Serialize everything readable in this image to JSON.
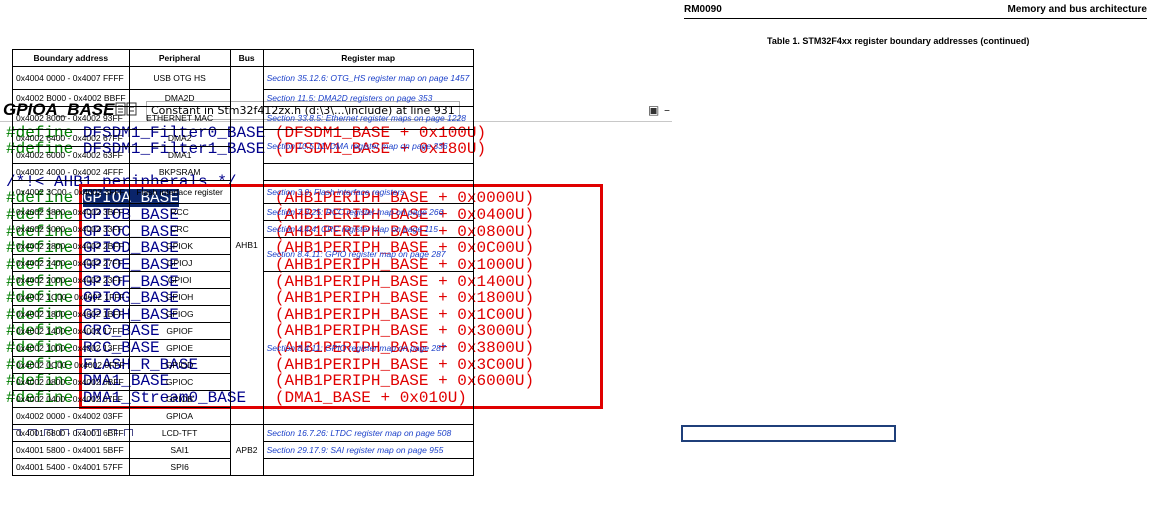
{
  "editor": {
    "symbol_name": "GPIOA_BASE",
    "tooltip": "Constant in Stm32f412zx.h (d:\\3\\...\\include) at line 931",
    "pin_glyph": "▣",
    "minimize_glyph": "–",
    "lines": [
      {
        "kw": "#define",
        "name": "DFSDM1_Filter0_BASE",
        "value": "(DFSDM1_BASE + 0x100U)"
      },
      {
        "kw": "#define",
        "name": "DFSDM1_Filter1_BASE",
        "value": "(DFSDM1_BASE + 0x180U)"
      },
      {
        "comment": "/*!< AHB1 peripherals */"
      },
      {
        "kw": "#define",
        "name": "GPIOA_BASE",
        "value": "(AHB1PERIPH_BASE + 0x0000U)",
        "selected": true
      },
      {
        "kw": "#define",
        "name": "GPIOB_BASE",
        "value": "(AHB1PERIPH_BASE + 0x0400U)"
      },
      {
        "kw": "#define",
        "name": "GPIOC_BASE",
        "value": "(AHB1PERIPH_BASE + 0x0800U)"
      },
      {
        "kw": "#define",
        "name": "GPIOD_BASE",
        "value": "(AHB1PERIPH_BASE + 0x0C00U)"
      },
      {
        "kw": "#define",
        "name": "GPIOE_BASE",
        "value": "(AHB1PERIPH_BASE + 0x1000U)"
      },
      {
        "kw": "#define",
        "name": "GPIOF_BASE",
        "value": "(AHB1PERIPH_BASE + 0x1400U)"
      },
      {
        "kw": "#define",
        "name": "GPIOG_BASE",
        "value": "(AHB1PERIPH_BASE + 0x1800U)"
      },
      {
        "kw": "#define",
        "name": "GPIOH_BASE",
        "value": "(AHB1PERIPH_BASE + 0x1C00U)"
      },
      {
        "kw": "#define",
        "name": "CRC_BASE",
        "value": "(AHB1PERIPH_BASE + 0x3000U)"
      },
      {
        "kw": "#define",
        "name": "RCC_BASE",
        "value": "(AHB1PERIPH_BASE + 0x3800U)"
      },
      {
        "kw": "#define",
        "name": "FLASH_R_BASE",
        "value": "(AHB1PERIPH_BASE + 0x3C00U)"
      },
      {
        "kw": "#define",
        "name": "DMA1_BASE",
        "value": "(AHB1PERIPH_BASE + 0x6000U)"
      },
      {
        "kw": "#define",
        "name": "DMA1_Stream0_BASE",
        "value": "(DMA1_BASE + 0x010U)"
      }
    ]
  },
  "manual": {
    "doc_code": "RM0090",
    "section_title": "Memory and bus architecture",
    "table_caption": "Table 1. STM32F4xx register boundary addresses (continued)",
    "headers": [
      "Boundary address",
      "Peripheral",
      "Bus",
      "Register map"
    ],
    "bus_labels": {
      "ahb1": "AHB1",
      "apb2": "APB2"
    },
    "rows": [
      {
        "addr": "0x4004 0000 - 0x4007 FFFF",
        "per": "USB OTG HS",
        "map": "Section 35.12.6: OTG_HS register map on page 1457"
      },
      {
        "addr": "0x4002 B000 - 0x4002 BBFF",
        "per": "DMA2D",
        "map": "Section 11.5: DMA2D registers on page 353"
      },
      {
        "addr": "0x4002 8000 - 0x4002 93FF",
        "per": "ETHERNET MAC",
        "map": "Section 33.8.5: Ethernet register maps on page 1228"
      },
      {
        "addr": "0x4002 6400 - 0x4002 67FF",
        "per": "DMA2",
        "map": "Section 10.5.11: DMA register map on page 336"
      },
      {
        "addr": "0x4002 6000 - 0x4002 63FF",
        "per": "DMA1"
      },
      {
        "addr": "0x4002 4000 - 0x4002 4FFF",
        "per": "BKPSRAM",
        "map": ""
      },
      {
        "addr": "0x4002 3C00 - 0x4002 3FFF",
        "per": "Flash interface register",
        "map": "Section 3.9: Flash interface registers"
      },
      {
        "addr": "0x4002 3800 - 0x4002 3BFF",
        "per": "RCC",
        "map": "Section 7.3.25: RCC register map on page 266"
      },
      {
        "addr": "0x4002 3000 - 0x4002 33FF",
        "per": "CRC",
        "map": "Section 4.4.4: CRC register map on page 115"
      },
      {
        "addr": "0x4002 2800 - 0x4002 2BFF",
        "per": "GPIOK",
        "map": "Section 8.4.11: GPIO register map on page 287"
      },
      {
        "addr": "0x4002 2400 - 0x4002 27FF",
        "per": "GPIOJ"
      },
      {
        "addr": "0x4002 2000 - 0x4002 23FF",
        "per": "GPIOI",
        "map": "Section 8.4.11: GPIO register map on page 287"
      },
      {
        "addr": "0x4002 1C00 - 0x4002 1FFF",
        "per": "GPIOH"
      },
      {
        "addr": "0x4002 1800 - 0x4002 1BFF",
        "per": "GPIOG"
      },
      {
        "addr": "0x4002 1400 - 0x4002 17FF",
        "per": "GPIOF"
      },
      {
        "addr": "0x4002 1000 - 0x4002 13FF",
        "per": "GPIOE"
      },
      {
        "addr": "0x4002 0C00 - 0x4002 0FFF",
        "per": "GPIOD"
      },
      {
        "addr": "0x4002 0800 - 0x4002 0BFF",
        "per": "GPIOC"
      },
      {
        "addr": "0x4002 0400 - 0x4002 07FF",
        "per": "GPIOB"
      },
      {
        "addr": "0x4002 0000 - 0x4002 03FF",
        "per": "GPIOA"
      },
      {
        "addr": "0x4001 6800 - 0x4001 6BFF",
        "per": "LCD-TFT",
        "map": "Section 16.7.26: LTDC register map on page 508"
      },
      {
        "addr": "0x4001 5800 - 0x4001 5BFF",
        "per": "SAI1",
        "map": "Section 29.17.9: SAI register map on page 955"
      },
      {
        "addr": "0x4001 5400 - 0x4001 57FF",
        "per": "SPI6",
        "map": ""
      }
    ]
  },
  "colors": {
    "keyword": "#008000",
    "identifier": "#00008b",
    "value": "#e00000",
    "selection": "#0a246a",
    "annotation_red": "#e00000",
    "annotation_blue": "#1f3f7a",
    "link_blue": "#1a3fc9"
  }
}
